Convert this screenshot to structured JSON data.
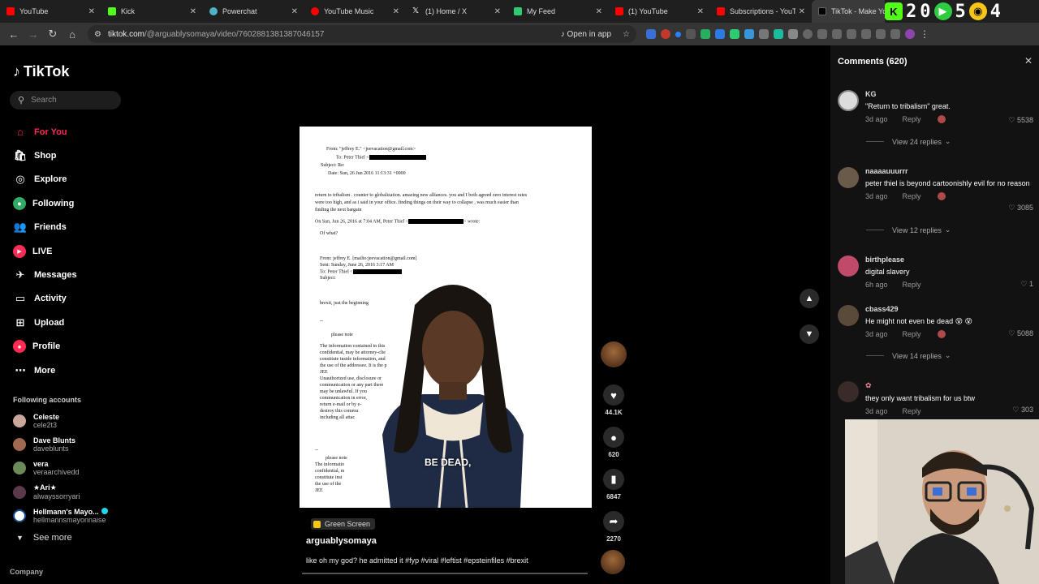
{
  "browser": {
    "tabs": [
      {
        "label": "YouTube",
        "color": "#ff0000"
      },
      {
        "label": "Kick",
        "color": "#53fc18"
      },
      {
        "label": "Powerchat",
        "color": "#4fb3c8"
      },
      {
        "label": "YouTube Music",
        "color": "#ff0000"
      },
      {
        "label": "(1) Home / X",
        "color": "#000000"
      },
      {
        "label": "My Feed",
        "color": "#2ecc71"
      },
      {
        "label": "(1) YouTube",
        "color": "#ff0000"
      },
      {
        "label": "Subscriptions - YouTube",
        "color": "#ff0000"
      },
      {
        "label": "TikTok - Make Yo",
        "color": "#000000"
      }
    ],
    "overlay_numbers": {
      "a": "2",
      "b": "0",
      "c": "5",
      "d": "4"
    },
    "url_host": "tiktok.com",
    "url_path": "/@arguablysomaya/video/7602881381387046157",
    "open_in_app": "Open in app"
  },
  "sidebar": {
    "logo": "TikTok",
    "search_placeholder": "Search",
    "nav": [
      {
        "label": "For You",
        "icon": "home-icon"
      },
      {
        "label": "Shop",
        "icon": "shop-icon"
      },
      {
        "label": "Explore",
        "icon": "compass-icon"
      },
      {
        "label": "Following",
        "icon": "following-icon"
      },
      {
        "label": "Friends",
        "icon": "friends-icon"
      },
      {
        "label": "LIVE",
        "icon": "live-icon"
      },
      {
        "label": "Messages",
        "icon": "messages-icon"
      },
      {
        "label": "Activity",
        "icon": "activity-icon"
      },
      {
        "label": "Upload",
        "icon": "upload-icon"
      },
      {
        "label": "Profile",
        "icon": "profile-icon"
      },
      {
        "label": "More",
        "icon": "more-icon"
      }
    ],
    "following_header": "Following accounts",
    "following": [
      {
        "name": "Celeste",
        "handle": "cele2t3"
      },
      {
        "name": "Dave Blunts",
        "handle": "daveblunts"
      },
      {
        "name": "vera",
        "handle": "veraarchivedd"
      },
      {
        "name": "★Ari★",
        "handle": "alwayssorryari"
      },
      {
        "name": "Hellmann's Mayo...",
        "handle": "hellmannsmayonnaise"
      }
    ],
    "see_more": "See more",
    "company": "Company"
  },
  "video": {
    "caption_overlay": "BE DEAD,",
    "badge": "Green Screen",
    "creator": "arguablysomaya",
    "description": "like oh my god? he admitted it #fyp #viral #leftist #epsteinfiles #brexit",
    "doc": {
      "from": "From: \"jeffrey E.\" <jeevacation@gmail.com>",
      "to": "To: Peter Thiel <",
      "subject": "Subject: Re:",
      "date": "Date: Sun, 26 Jun 2016 11:13:31 +0000",
      "body1": "return to tribalism .  counter to globalization.  amazing new alliances.   you and I both agreed zero interest rates",
      "body2": "were too high,  and as i said in your office.  finding things on their way to collapse , was much easier than",
      "body3": "finding the next bargain",
      "quote": "On Sun, Jun 26, 2016 at 7:04 AM, Peter Thiel <",
      "wrote": "> wrote:",
      "ofwhat": "Of what?",
      "from2": "From: jeffrey E. [mailto:jeevacation@gmail.com]",
      "sent2": "Sent: Sunday, June 26, 2016 3:17 AM",
      "to2": "To: Peter Thiel <",
      "subject2": "Subject:",
      "brexit": "brexit,  just the beginning",
      "dashes": "--",
      "pleasenote": "please note",
      "conf1": "The information contained in this",
      "conf2": "confidential, may be attorney-clie",
      "conf3": "constitute inside information, and",
      "conf4": "the use of the addressee. It is the p",
      "jee": "JEE",
      "unauth": "Unauthorized use, disclosure or",
      "comm": "communication or any part there",
      "unlaw": "may be unlawful. If you",
      "comerr": "communication in error,",
      "remail": "return e-mail or by e-",
      "destroy": "destroy this commu",
      "incl": "including all attac",
      "dashes2": "--",
      "pleasenote2": "please note",
      "info2": "The informatio",
      "conf2b": "confidential, m",
      "const2": "constitute insi",
      "use2": "the use of the",
      "jee2": "JEE"
    }
  },
  "actions": {
    "likes": "44.1K",
    "comments": "620",
    "saves": "6847",
    "shares": "2270"
  },
  "comments_panel": {
    "title": "Comments (620)",
    "items": [
      {
        "user": "KG",
        "text": "\"Return to tribalism\" great.",
        "age": "3d ago",
        "reply": "Reply",
        "likes": "5538",
        "view_replies": "View 24 replies"
      },
      {
        "user": "naaaauuurrr",
        "text": "peter thiel is beyond cartoonishly evil for no reason",
        "age": "3d ago",
        "reply": "Reply",
        "likes": "3085",
        "view_replies": "View 12 replies"
      },
      {
        "user": "birthplease",
        "text": "digital slavery",
        "age": "6h ago",
        "reply": "Reply",
        "likes": "1"
      },
      {
        "user": "cbass429",
        "text": "He might not even be dead 😵 😵",
        "age": "3d ago",
        "reply": "Reply",
        "likes": "5088",
        "view_replies": "View 14 replies"
      },
      {
        "user": "✿",
        "text": "they only want tribalism for us btw",
        "age": "3d ago",
        "reply": "Reply",
        "likes": "303"
      }
    ]
  }
}
